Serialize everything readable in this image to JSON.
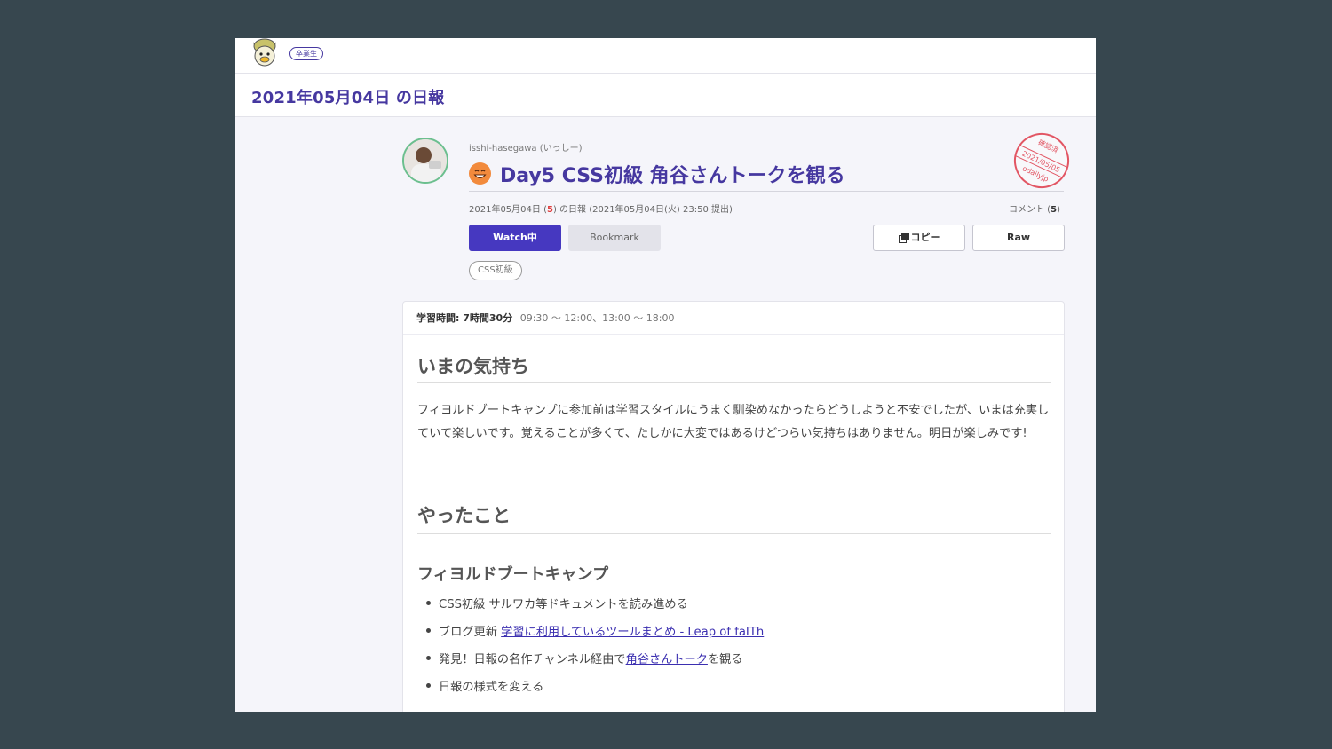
{
  "header": {
    "badge": "卒業生",
    "page_title": "2021年05月04日 の日報"
  },
  "report": {
    "author": "isshi-hasegawa (いっしー)",
    "title": "Day5 CSS初級 角谷さんトークを観る",
    "meta_prefix": "2021年05月04日 (",
    "meta_count": "5",
    "meta_suffix": ") の日報 (2021年05月04日(火) 23:50 提出)",
    "comment_label": "コメント (",
    "comment_count": "5",
    "comment_close": ")",
    "stamp": {
      "top": "確認済",
      "date": "2021/05/05",
      "user": "odailyjp"
    },
    "buttons": {
      "watch": "Watch中",
      "bookmark": "Bookmark",
      "copy": "コピー",
      "raw": "Raw"
    },
    "tag": "CSS初級"
  },
  "body": {
    "study_label": "学習時間: 7時間30分",
    "study_time": "09:30 〜 12:00、13:00 〜 18:00",
    "h_feeling": "いまの気持ち",
    "feeling_text": "フィヨルドブートキャンプに参加前は学習スタイルにうまく馴染めなかったらどうしようと不安でしたが、いまは充実していて楽しいです。覚えることが多くて、たしかに大変ではあるけどつらい気持ちはありません。明日が楽しみです!",
    "h_done": "やったこと",
    "h_fbc": "フィヨルドブートキャンプ",
    "items": [
      {
        "text": "CSS初級 サルワカ等ドキュメントを読み進める"
      },
      {
        "prefix": "ブログ更新 ",
        "link": "学習に利用しているツールまとめ - Leap of faITh",
        "suffix": ""
      },
      {
        "prefix": "発見！日報の名作チャンネル経由で",
        "link": "角谷さんトーク",
        "suffix": "を観る"
      },
      {
        "text": "日報の様式を変える"
      }
    ]
  },
  "colors": {
    "background": "#37474f",
    "brand": "#4638c0",
    "title": "#4638a0",
    "stamp": "#e25563"
  }
}
